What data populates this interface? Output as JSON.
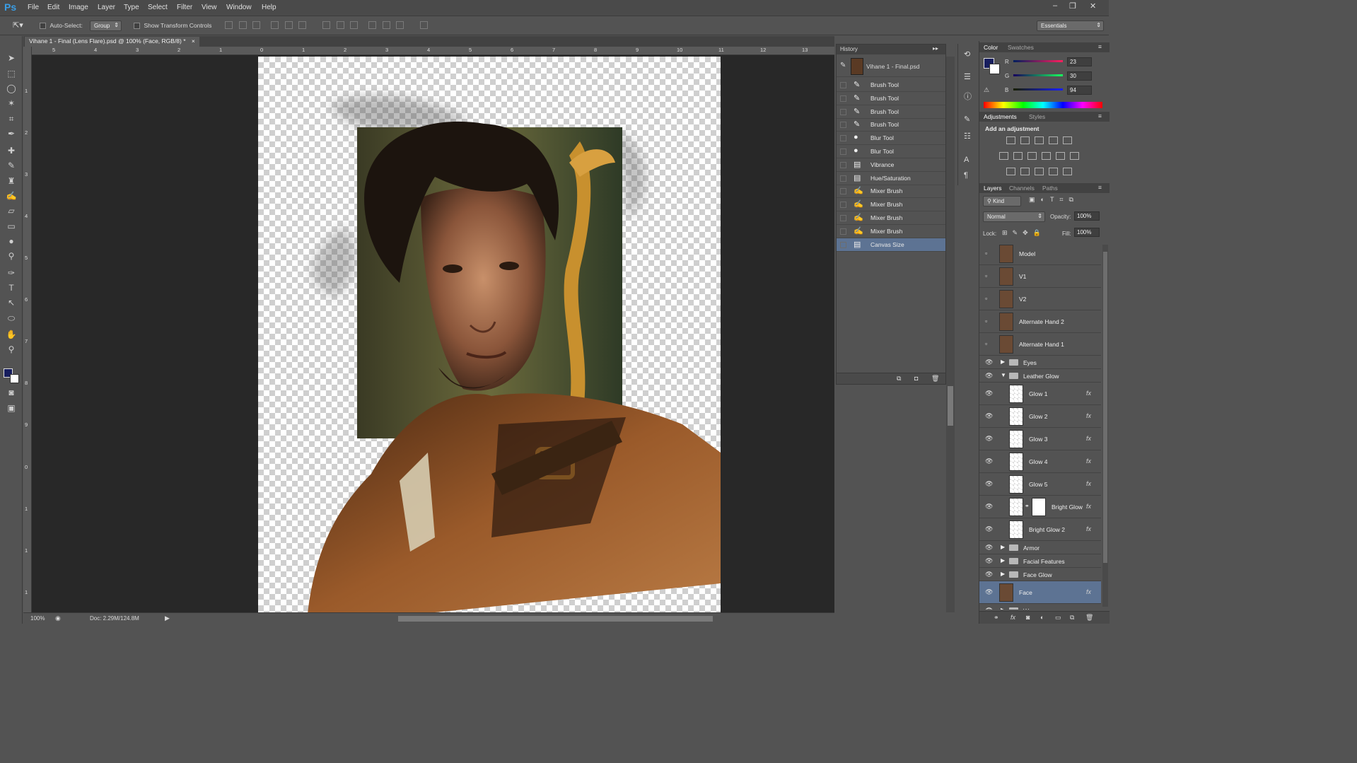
{
  "app": {
    "logo": "Ps",
    "menus": [
      "File",
      "Edit",
      "Image",
      "Layer",
      "Type",
      "Select",
      "Filter",
      "View",
      "Window",
      "Help"
    ],
    "window_controls": [
      "–",
      "❐",
      "✕"
    ]
  },
  "options": {
    "auto_select_label": "Auto-Select:",
    "auto_select_value": "Group",
    "show_transform_label": "Show Transform Controls",
    "workspace": "Essentials"
  },
  "document": {
    "tab_title": "Vihane 1 - Final (Lens Flare).psd @ 100% (Face, RGB/8) *",
    "zoom": "100%",
    "doc_info": "Doc: 2.29M/124.8M",
    "ruler_h": [
      "5",
      "4",
      "3",
      "2",
      "1",
      "0",
      "1",
      "2",
      "3",
      "4",
      "5",
      "6",
      "7",
      "8",
      "9",
      "10",
      "11",
      "12",
      "13"
    ],
    "ruler_v": [
      "1",
      "2",
      "3",
      "4",
      "5",
      "6",
      "7",
      "8",
      "9",
      "0",
      "1",
      "1",
      "1"
    ]
  },
  "tools": [
    "move",
    "marquee",
    "lasso",
    "magic-wand",
    "crop",
    "eyedropper",
    "healing",
    "brush",
    "stamp",
    "history-brush",
    "eraser",
    "gradient",
    "blur",
    "dodge",
    "pen",
    "type",
    "path-select",
    "shape",
    "hand",
    "zoom"
  ],
  "history": {
    "title": "History",
    "snapshot": "Vihane 1 - Final.psd",
    "items": [
      {
        "label": "Brush Tool",
        "icon": "brush-icon"
      },
      {
        "label": "Brush Tool",
        "icon": "brush-icon"
      },
      {
        "label": "Brush Tool",
        "icon": "brush-icon"
      },
      {
        "label": "Brush Tool",
        "icon": "brush-icon"
      },
      {
        "label": "Blur Tool",
        "icon": "drop-icon"
      },
      {
        "label": "Blur Tool",
        "icon": "drop-icon"
      },
      {
        "label": "Vibrance",
        "icon": "doc-icon"
      },
      {
        "label": "Hue/Saturation",
        "icon": "doc-icon"
      },
      {
        "label": "Mixer Brush",
        "icon": "mixer-brush-icon"
      },
      {
        "label": "Mixer Brush",
        "icon": "mixer-brush-icon"
      },
      {
        "label": "Mixer Brush",
        "icon": "mixer-brush-icon"
      },
      {
        "label": "Mixer Brush",
        "icon": "mixer-brush-icon"
      },
      {
        "label": "Canvas Size",
        "icon": "doc-icon",
        "selected": true
      }
    ]
  },
  "color": {
    "tabs": [
      "Color",
      "Swatches"
    ],
    "r_label": "R",
    "g_label": "G",
    "b_label": "B",
    "r": "23",
    "g": "30",
    "b": "94",
    "foreground": "#171e5e",
    "background": "#ffffff"
  },
  "adjustments": {
    "tabs": [
      "Adjustments",
      "Styles"
    ],
    "heading": "Add an adjustment"
  },
  "layers": {
    "tabs": [
      "Layers",
      "Channels",
      "Paths"
    ],
    "filter": "Kind",
    "blend_mode": "Normal",
    "opacity_label": "Opacity:",
    "opacity": "100%",
    "lock_label": "Lock:",
    "fill_label": "Fill:",
    "fill": "100%",
    "items": [
      {
        "name": "Model",
        "type": "layer",
        "visible": false
      },
      {
        "name": "V1",
        "type": "layer",
        "visible": false
      },
      {
        "name": "V2",
        "type": "layer",
        "visible": false
      },
      {
        "name": "Alternate Hand 2",
        "type": "layer",
        "visible": false
      },
      {
        "name": "Alternate Hand 1",
        "type": "layer",
        "visible": false
      },
      {
        "name": "Eyes",
        "type": "group",
        "visible": true,
        "expanded": false
      },
      {
        "name": "Leather Glow",
        "type": "group",
        "visible": true,
        "expanded": true
      },
      {
        "name": "Glow 1",
        "type": "layer",
        "visible": true,
        "fx": true,
        "child": true
      },
      {
        "name": "Glow 2",
        "type": "layer",
        "visible": true,
        "fx": true,
        "child": true
      },
      {
        "name": "Glow 3",
        "type": "layer",
        "visible": true,
        "fx": true,
        "child": true
      },
      {
        "name": "Glow 4",
        "type": "layer",
        "visible": true,
        "fx": true,
        "child": true
      },
      {
        "name": "Glow 5",
        "type": "layer",
        "visible": true,
        "fx": true,
        "child": true
      },
      {
        "name": "Bright Glow",
        "type": "layer",
        "visible": true,
        "fx": true,
        "child": true,
        "mask": true
      },
      {
        "name": "Bright Glow 2",
        "type": "layer",
        "visible": true,
        "fx": true,
        "child": true
      },
      {
        "name": "Armor",
        "type": "group",
        "visible": true,
        "expanded": false
      },
      {
        "name": "Facial Features",
        "type": "group",
        "visible": true,
        "expanded": false
      },
      {
        "name": "Face Glow",
        "type": "group",
        "visible": true,
        "expanded": false
      },
      {
        "name": "Face",
        "type": "layer",
        "visible": true,
        "fx": true,
        "selected": true
      },
      {
        "name": "Weapons",
        "type": "group",
        "visible": true,
        "expanded": false
      }
    ]
  }
}
